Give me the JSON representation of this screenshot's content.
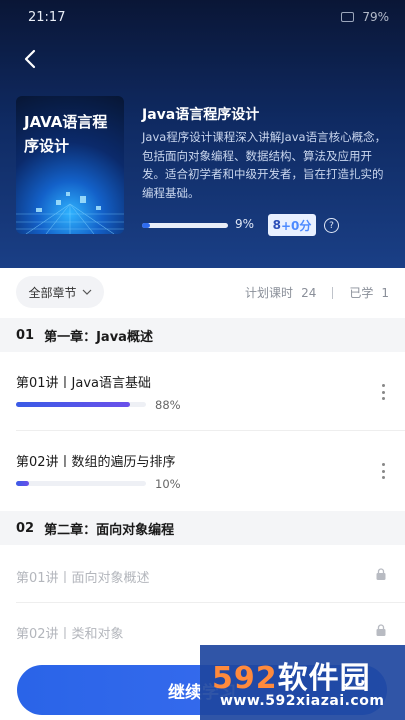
{
  "status": {
    "time": "21:17",
    "battery": "79%"
  },
  "course": {
    "cover_title": "JAVA语言程序设计",
    "title": "Java语言程序设计",
    "description": "Java程序设计课程深入讲解Java语言核心概念，包括面向对象编程、数据结构、算法及应用开发。适合初学者和中级开发者，旨在打造扎实的编程基础。",
    "progress_percent": 9,
    "progress_text": "9%",
    "score_base": "8",
    "score_plus": "+0分",
    "help_icon": "?"
  },
  "filter": {
    "label": "全部章节"
  },
  "plan": {
    "planned_label": "计划课时",
    "planned_value": "24",
    "learned_label": "已学",
    "learned_value": "1"
  },
  "chapters": [
    {
      "num": "01",
      "title": "第一章：Java概述",
      "lessons": [
        {
          "title": "第01讲丨Java语言基础",
          "progress": 88,
          "pct": "88%"
        },
        {
          "title": "第02讲丨数组的遍历与排序",
          "progress": 10,
          "pct": "10%"
        }
      ]
    },
    {
      "num": "02",
      "title": "第二章：面向对象编程",
      "lessons": [
        {
          "title": "第01讲丨面向对象概述",
          "locked": true
        },
        {
          "title": "第02讲丨类和对象",
          "locked": true
        }
      ]
    }
  ],
  "cta": {
    "label": "继续学习"
  },
  "watermark": {
    "brand_a": "592",
    "brand_b": "软件园",
    "url": "www.592xiazai.com"
  },
  "colors": {
    "accent": "#2f6cf0",
    "header_top": "#0a1636",
    "header_bottom": "#1a3f86"
  }
}
